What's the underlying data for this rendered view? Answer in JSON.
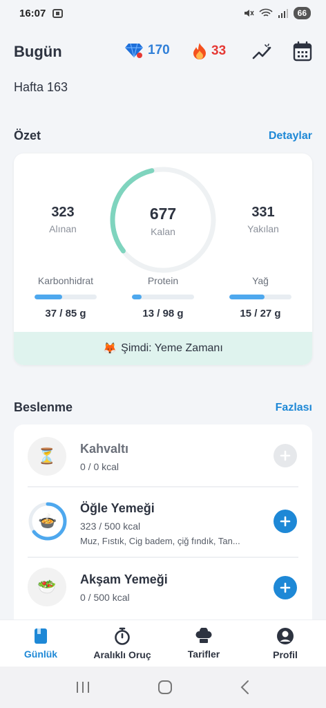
{
  "status_bar": {
    "time": "16:07",
    "battery": "66"
  },
  "header": {
    "title": "Bugün",
    "gems": "170",
    "streak": "33",
    "week_label": "Hafta 163",
    "icons": [
      "gem-icon",
      "fire-icon",
      "trend-icon",
      "calendar-icon"
    ]
  },
  "summary": {
    "section_label": "Özet",
    "details_link": "Detaylar",
    "eaten": {
      "value": "323",
      "label": "Alınan"
    },
    "remaining": {
      "value": "677",
      "label": "Kalan"
    },
    "burned": {
      "value": "331",
      "label": "Yakılan"
    },
    "gauge_progress": 0.32,
    "macros": [
      {
        "label": "Karbonhidrat",
        "value": "37 / 85 g",
        "fraction": 0.44
      },
      {
        "label": "Protein",
        "value": "13 / 98 g",
        "fraction": 0.15
      },
      {
        "label": "Yağ",
        "value": "15 / 27 g",
        "fraction": 0.57
      }
    ],
    "banner_emoji": "🦊",
    "banner_text": "Şimdi: Yeme Zamanı"
  },
  "nutrition": {
    "section_label": "Beslenme",
    "more_link": "Fazlası",
    "meals": [
      {
        "name": "Kahvaltı",
        "kcal": "0 / 0 kcal",
        "foods": "",
        "progress": 0,
        "icon": "hourglass-icon",
        "emoji": "⏳",
        "enabled": false
      },
      {
        "name": "Öğle Yemeği",
        "kcal": "323 / 500 kcal",
        "foods": "Muz, Fıstık, Cig badem, çiğ fındık, Tan...",
        "progress": 0.646,
        "icon": "lunch-bowl-icon",
        "emoji": "🍲",
        "enabled": true
      },
      {
        "name": "Akşam Yemeği",
        "kcal": "0 / 500 kcal",
        "foods": "",
        "progress": 0,
        "icon": "salad-icon",
        "emoji": "🥗",
        "enabled": true
      }
    ]
  },
  "bottom_nav": {
    "tabs": [
      {
        "label": "Günlük",
        "active": true
      },
      {
        "label": "Aralıklı Oruç",
        "active": false
      },
      {
        "label": "Tarifler",
        "active": false
      },
      {
        "label": "Profil",
        "active": false
      }
    ]
  },
  "colors": {
    "accent": "#1e88d6",
    "gauge": "#7fd4be",
    "macro_bar": "#4ea8ee",
    "banner": "#dff3ee"
  }
}
